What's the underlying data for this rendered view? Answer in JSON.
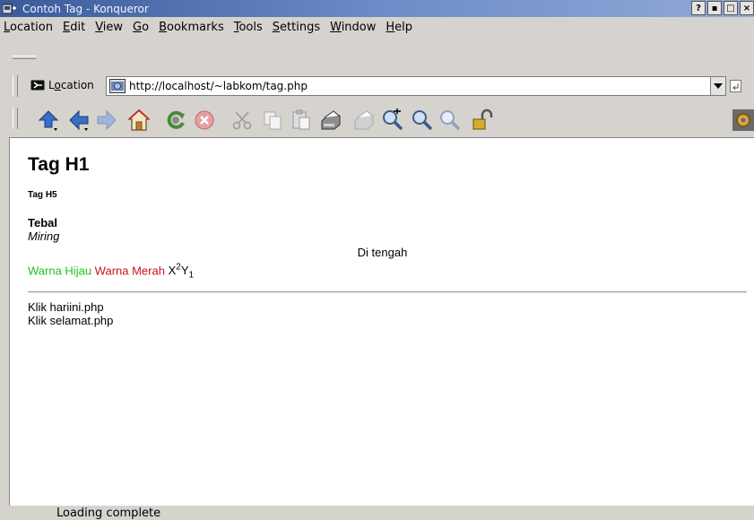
{
  "window": {
    "title": "Contoh Tag - Konqueror",
    "buttons": [
      "?",
      "▪",
      "□",
      "×"
    ]
  },
  "menu": {
    "items": [
      {
        "ul": "L",
        "rest": "ocation"
      },
      {
        "ul": "E",
        "rest": "dit"
      },
      {
        "ul": "V",
        "rest": "iew"
      },
      {
        "ul": "G",
        "rest": "o"
      },
      {
        "ul": "B",
        "rest": "ookmarks"
      },
      {
        "ul": "T",
        "rest": "ools"
      },
      {
        "ul": "S",
        "rest": "ettings"
      },
      {
        "ul": "W",
        "rest": "indow"
      },
      {
        "ul": "H",
        "rest": "elp"
      }
    ]
  },
  "locationbar": {
    "label_ul": "o",
    "label_pre": "L",
    "label_post": "cation",
    "url": "http://localhost/~labkom/tag.php"
  },
  "toolbar": {
    "icons": [
      "up-icon",
      "back-icon",
      "forward-icon",
      "home-icon",
      "reload-icon",
      "stop-icon",
      "cut-icon",
      "copy-icon",
      "paste-icon",
      "print-icon",
      "print-frame-icon",
      "zoom-in-icon",
      "zoom-out-icon",
      "zoom-icon",
      "security-lock-icon",
      "gear-icon"
    ]
  },
  "content": {
    "h1": "Tag H1",
    "h5": "Tag H5",
    "bold": "Tebal",
    "italic": "Miring",
    "center": "Di tengah",
    "green": "Warna Hijau",
    "red": "Warna Merah",
    "sup_base": "X",
    "sup": "2",
    "sub_base": "Y",
    "sub": "1",
    "link1": "Klik hariini.php",
    "link2": "Klik selamat.php"
  },
  "status": {
    "text": "Loading complete"
  },
  "colors": {
    "green_text": "#22c122",
    "red_text": "#c8141e",
    "titlebar": "#3a5a9a"
  }
}
